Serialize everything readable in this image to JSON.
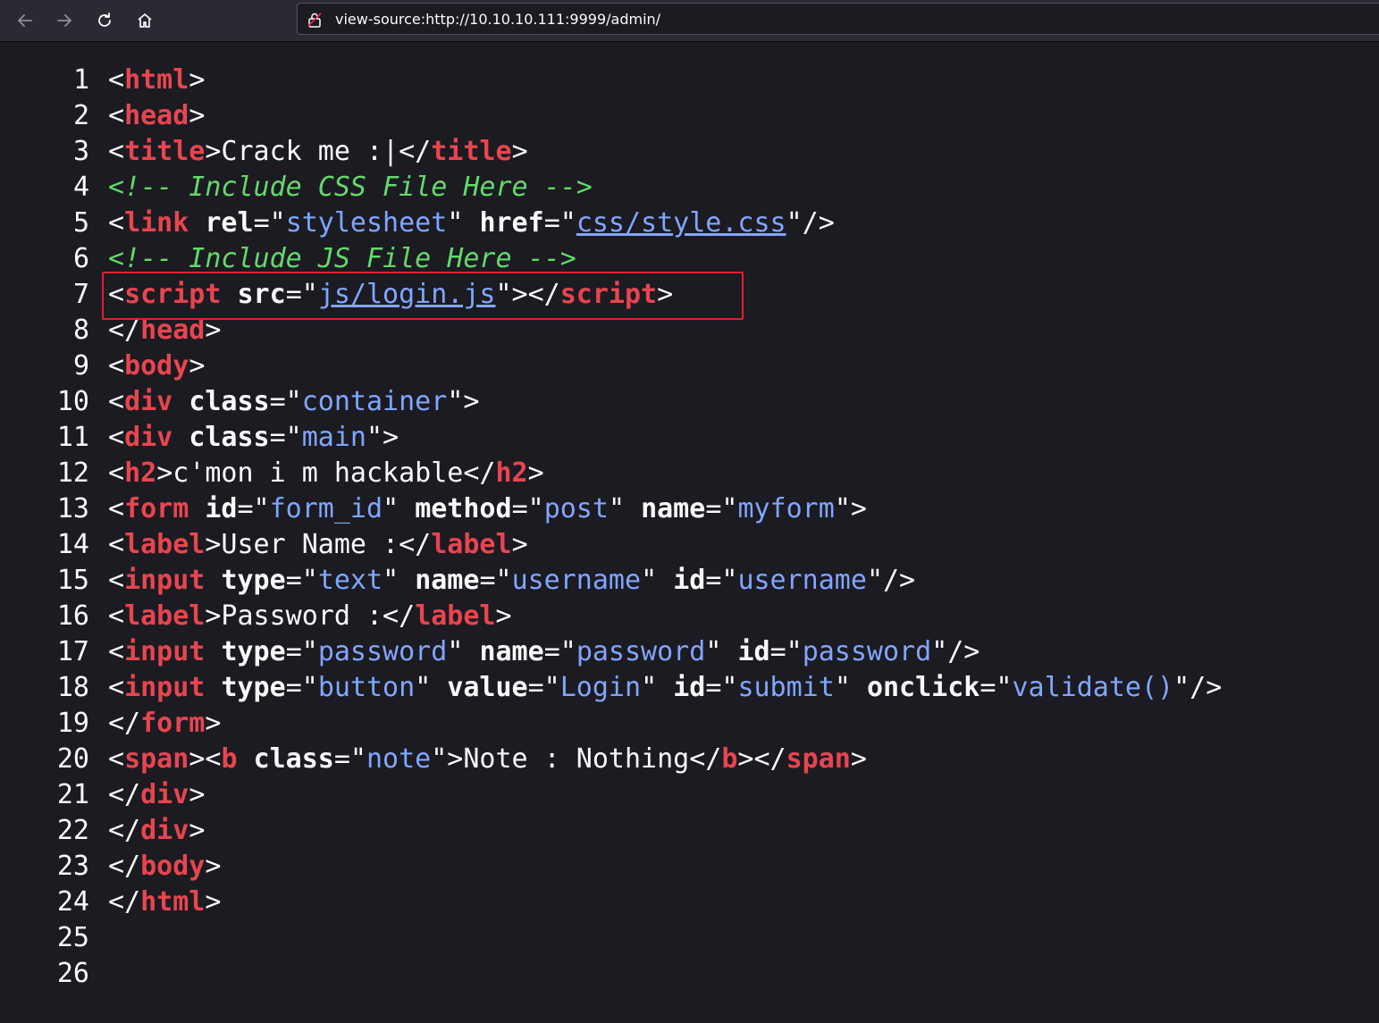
{
  "browser": {
    "url": "view-source:http://10.10.10.111:9999/admin/"
  },
  "colors": {
    "tag": "#e8454f",
    "value": "#80a6ff",
    "comment": "#63d96a",
    "text": "#fbfbfe",
    "highlight": "#e0212d",
    "background": "#1c1b22"
  },
  "source_lines": [
    {
      "n": "1",
      "tokens": [
        [
          "p",
          "<"
        ],
        [
          "t",
          "html"
        ],
        [
          "p",
          ">"
        ]
      ]
    },
    {
      "n": "2",
      "tokens": [
        [
          "p",
          "<"
        ],
        [
          "t",
          "head"
        ],
        [
          "p",
          ">"
        ]
      ]
    },
    {
      "n": "3",
      "tokens": [
        [
          "p",
          "<"
        ],
        [
          "t",
          "title"
        ],
        [
          "p",
          ">Crack me :|</"
        ],
        [
          "t",
          "title"
        ],
        [
          "p",
          ">"
        ]
      ]
    },
    {
      "n": "4",
      "tokens": [
        [
          "c",
          "<!-- Include CSS File Here -->"
        ]
      ]
    },
    {
      "n": "5",
      "tokens": [
        [
          "p",
          "<"
        ],
        [
          "t",
          "link"
        ],
        [
          "p",
          " "
        ],
        [
          "a",
          "rel"
        ],
        [
          "p",
          "=\""
        ],
        [
          "v",
          "stylesheet"
        ],
        [
          "p",
          "\" "
        ],
        [
          "a",
          "href"
        ],
        [
          "p",
          "=\""
        ],
        [
          "l",
          "css/style.css"
        ],
        [
          "p",
          "\"/>"
        ]
      ]
    },
    {
      "n": "6",
      "tokens": [
        [
          "c",
          "<!-- Include JS File Here -->"
        ]
      ]
    },
    {
      "n": "7",
      "tokens": [
        [
          "p",
          "<"
        ],
        [
          "t",
          "script"
        ],
        [
          "p",
          " "
        ],
        [
          "a",
          "src"
        ],
        [
          "p",
          "=\""
        ],
        [
          "l",
          "js/login.js"
        ],
        [
          "p",
          "\"></"
        ],
        [
          "t",
          "script"
        ],
        [
          "p",
          ">"
        ]
      ]
    },
    {
      "n": "8",
      "tokens": [
        [
          "p",
          "</"
        ],
        [
          "t",
          "head"
        ],
        [
          "p",
          ">"
        ]
      ]
    },
    {
      "n": "9",
      "tokens": [
        [
          "p",
          "<"
        ],
        [
          "t",
          "body"
        ],
        [
          "p",
          ">"
        ]
      ]
    },
    {
      "n": "10",
      "tokens": [
        [
          "p",
          "<"
        ],
        [
          "t",
          "div"
        ],
        [
          "p",
          " "
        ],
        [
          "a",
          "class"
        ],
        [
          "p",
          "=\""
        ],
        [
          "v",
          "container"
        ],
        [
          "p",
          "\">"
        ]
      ]
    },
    {
      "n": "11",
      "tokens": [
        [
          "p",
          "<"
        ],
        [
          "t",
          "div"
        ],
        [
          "p",
          " "
        ],
        [
          "a",
          "class"
        ],
        [
          "p",
          "=\""
        ],
        [
          "v",
          "main"
        ],
        [
          "p",
          "\">"
        ]
      ]
    },
    {
      "n": "12",
      "tokens": [
        [
          "p",
          "<"
        ],
        [
          "t",
          "h2"
        ],
        [
          "p",
          ">c'mon i m hackable</"
        ],
        [
          "t",
          "h2"
        ],
        [
          "p",
          ">"
        ]
      ]
    },
    {
      "n": "13",
      "tokens": [
        [
          "p",
          "<"
        ],
        [
          "t",
          "form"
        ],
        [
          "p",
          " "
        ],
        [
          "a",
          "id"
        ],
        [
          "p",
          "=\""
        ],
        [
          "v",
          "form_id"
        ],
        [
          "p",
          "\" "
        ],
        [
          "a",
          "method"
        ],
        [
          "p",
          "=\""
        ],
        [
          "v",
          "post"
        ],
        [
          "p",
          "\" "
        ],
        [
          "a",
          "name"
        ],
        [
          "p",
          "=\""
        ],
        [
          "v",
          "myform"
        ],
        [
          "p",
          "\">"
        ]
      ]
    },
    {
      "n": "14",
      "tokens": [
        [
          "p",
          "<"
        ],
        [
          "t",
          "label"
        ],
        [
          "p",
          ">User Name :</"
        ],
        [
          "t",
          "label"
        ],
        [
          "p",
          ">"
        ]
      ]
    },
    {
      "n": "15",
      "tokens": [
        [
          "p",
          "<"
        ],
        [
          "t",
          "input"
        ],
        [
          "p",
          " "
        ],
        [
          "a",
          "type"
        ],
        [
          "p",
          "=\""
        ],
        [
          "v",
          "text"
        ],
        [
          "p",
          "\" "
        ],
        [
          "a",
          "name"
        ],
        [
          "p",
          "=\""
        ],
        [
          "v",
          "username"
        ],
        [
          "p",
          "\" "
        ],
        [
          "a",
          "id"
        ],
        [
          "p",
          "=\""
        ],
        [
          "v",
          "username"
        ],
        [
          "p",
          "\"/>"
        ]
      ]
    },
    {
      "n": "16",
      "tokens": [
        [
          "p",
          "<"
        ],
        [
          "t",
          "label"
        ],
        [
          "p",
          ">Password :</"
        ],
        [
          "t",
          "label"
        ],
        [
          "p",
          ">"
        ]
      ]
    },
    {
      "n": "17",
      "tokens": [
        [
          "p",
          "<"
        ],
        [
          "t",
          "input"
        ],
        [
          "p",
          " "
        ],
        [
          "a",
          "type"
        ],
        [
          "p",
          "=\""
        ],
        [
          "v",
          "password"
        ],
        [
          "p",
          "\" "
        ],
        [
          "a",
          "name"
        ],
        [
          "p",
          "=\""
        ],
        [
          "v",
          "password"
        ],
        [
          "p",
          "\" "
        ],
        [
          "a",
          "id"
        ],
        [
          "p",
          "=\""
        ],
        [
          "v",
          "password"
        ],
        [
          "p",
          "\"/>"
        ]
      ]
    },
    {
      "n": "18",
      "tokens": [
        [
          "p",
          "<"
        ],
        [
          "t",
          "input"
        ],
        [
          "p",
          " "
        ],
        [
          "a",
          "type"
        ],
        [
          "p",
          "=\""
        ],
        [
          "v",
          "button"
        ],
        [
          "p",
          "\" "
        ],
        [
          "a",
          "value"
        ],
        [
          "p",
          "=\""
        ],
        [
          "v",
          "Login"
        ],
        [
          "p",
          "\" "
        ],
        [
          "a",
          "id"
        ],
        [
          "p",
          "=\""
        ],
        [
          "v",
          "submit"
        ],
        [
          "p",
          "\" "
        ],
        [
          "a",
          "onclick"
        ],
        [
          "p",
          "=\""
        ],
        [
          "v",
          "validate()"
        ],
        [
          "p",
          "\"/>"
        ]
      ]
    },
    {
      "n": "19",
      "tokens": [
        [
          "p",
          "</"
        ],
        [
          "t",
          "form"
        ],
        [
          "p",
          ">"
        ]
      ]
    },
    {
      "n": "20",
      "tokens": [
        [
          "p",
          "<"
        ],
        [
          "t",
          "span"
        ],
        [
          "p",
          "><"
        ],
        [
          "t",
          "b"
        ],
        [
          "p",
          " "
        ],
        [
          "a",
          "class"
        ],
        [
          "p",
          "=\""
        ],
        [
          "v",
          "note"
        ],
        [
          "p",
          "\">Note : Nothing</"
        ],
        [
          "t",
          "b"
        ],
        [
          "p",
          "></"
        ],
        [
          "t",
          "span"
        ],
        [
          "p",
          ">"
        ]
      ]
    },
    {
      "n": "21",
      "tokens": [
        [
          "p",
          "</"
        ],
        [
          "t",
          "div"
        ],
        [
          "p",
          ">"
        ]
      ]
    },
    {
      "n": "22",
      "tokens": [
        [
          "p",
          "</"
        ],
        [
          "t",
          "div"
        ],
        [
          "p",
          ">"
        ]
      ]
    },
    {
      "n": "23",
      "tokens": [
        [
          "p",
          "</"
        ],
        [
          "t",
          "body"
        ],
        [
          "p",
          ">"
        ]
      ]
    },
    {
      "n": "24",
      "tokens": [
        [
          "p",
          "</"
        ],
        [
          "t",
          "html"
        ],
        [
          "p",
          ">"
        ]
      ]
    },
    {
      "n": "25",
      "tokens": []
    },
    {
      "n": "26",
      "tokens": []
    }
  ]
}
